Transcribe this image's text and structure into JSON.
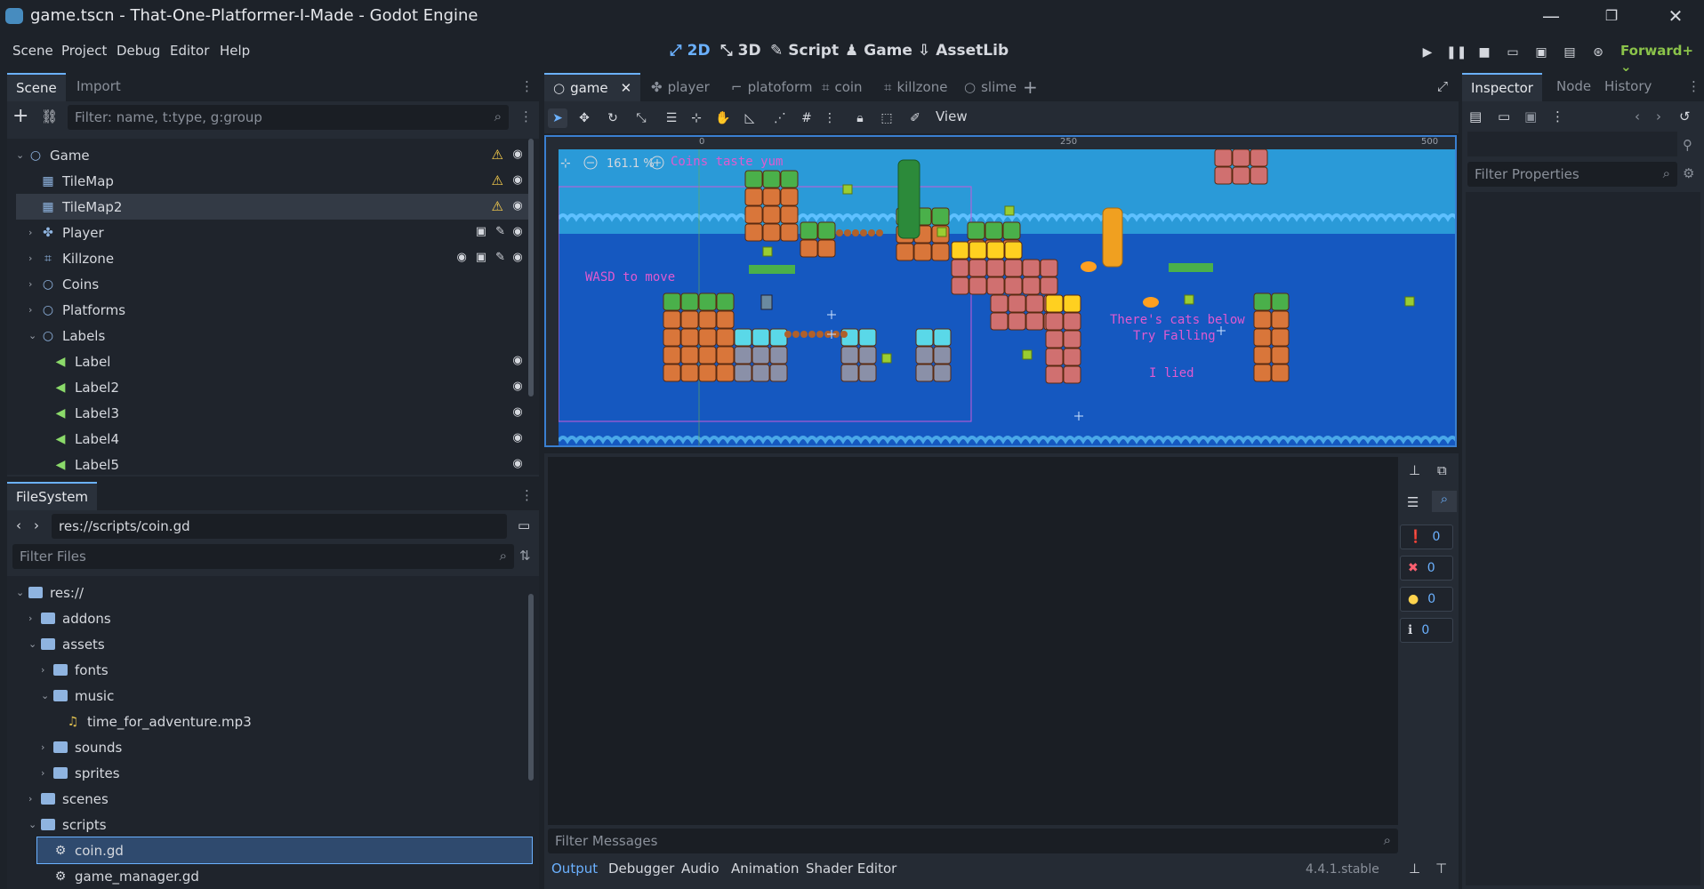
{
  "window": {
    "title": "game.tscn - That-One-Platformer-I-Made - Godot Engine",
    "minimize": "—",
    "maximize": "❐",
    "close": "✕"
  },
  "menu": [
    "Scene",
    "Project",
    "Debug",
    "Editor",
    "Help"
  ],
  "workspaces": [
    {
      "label": "2D",
      "icon": "2d-icon",
      "active": true
    },
    {
      "label": "3D",
      "icon": "3d-icon",
      "active": false
    },
    {
      "label": "Script",
      "icon": "script-icon",
      "active": false
    },
    {
      "label": "Game",
      "icon": "game-icon",
      "active": false
    },
    {
      "label": "AssetLib",
      "icon": "assetlib-icon",
      "active": false
    }
  ],
  "renderer": "Forward+",
  "scene_panel": {
    "tabs": [
      "Scene",
      "Import"
    ],
    "filter_placeholder": "Filter: name, t:type, g:group",
    "nodes": [
      {
        "name": "Game",
        "depth": 0,
        "expanded": true,
        "icon": "node2d-icon",
        "warn": true,
        "eye": true
      },
      {
        "name": "TileMap",
        "depth": 1,
        "icon": "tilemap-icon",
        "warn": true,
        "eye": true
      },
      {
        "name": "TileMap2",
        "depth": 1,
        "icon": "tilemap-icon",
        "warn": true,
        "eye": true,
        "selected": true
      },
      {
        "name": "Player",
        "depth": 1,
        "collapsed": true,
        "icon": "character-icon",
        "eye": true,
        "extras": [
          "scene",
          "script"
        ]
      },
      {
        "name": "Killzone",
        "depth": 1,
        "collapsed": true,
        "icon": "area-icon",
        "eye": true,
        "extras": [
          "signal",
          "scene",
          "script"
        ]
      },
      {
        "name": "Coins",
        "depth": 1,
        "collapsed": true,
        "icon": "node2d-icon"
      },
      {
        "name": "Platforms",
        "depth": 1,
        "collapsed": true,
        "icon": "node2d-icon"
      },
      {
        "name": "Labels",
        "depth": 1,
        "expanded": true,
        "icon": "node2d-icon"
      },
      {
        "name": "Label",
        "depth": 2,
        "icon": "label-icon",
        "eye": true
      },
      {
        "name": "Label2",
        "depth": 2,
        "icon": "label-icon",
        "eye": true
      },
      {
        "name": "Label3",
        "depth": 2,
        "icon": "label-icon",
        "eye": true
      },
      {
        "name": "Label4",
        "depth": 2,
        "icon": "label-icon",
        "eye": true
      },
      {
        "name": "Label5",
        "depth": 2,
        "icon": "label-icon",
        "eye": true
      }
    ]
  },
  "filesystem": {
    "tab": "FileSystem",
    "path": "res://scripts/coin.gd",
    "filter_placeholder": "Filter Files",
    "items": [
      {
        "name": "res://",
        "depth": 0,
        "type": "folder",
        "expanded": true
      },
      {
        "name": "addons",
        "depth": 1,
        "type": "folder",
        "collapsed": true
      },
      {
        "name": "assets",
        "depth": 1,
        "type": "folder",
        "expanded": true
      },
      {
        "name": "fonts",
        "depth": 2,
        "type": "folder",
        "collapsed": true
      },
      {
        "name": "music",
        "depth": 2,
        "type": "folder",
        "expanded": true
      },
      {
        "name": "time_for_adventure.mp3",
        "depth": 3,
        "type": "audio"
      },
      {
        "name": "sounds",
        "depth": 2,
        "type": "folder",
        "collapsed": true
      },
      {
        "name": "sprites",
        "depth": 2,
        "type": "folder",
        "collapsed": true
      },
      {
        "name": "scenes",
        "depth": 1,
        "type": "folder",
        "collapsed": true
      },
      {
        "name": "scripts",
        "depth": 1,
        "type": "folder",
        "expanded": true
      },
      {
        "name": "coin.gd",
        "depth": 2,
        "type": "script",
        "selected": true
      },
      {
        "name": "game_manager.gd",
        "depth": 2,
        "type": "script"
      }
    ]
  },
  "editor_tabs": [
    {
      "label": "game",
      "active": true
    },
    {
      "label": "player"
    },
    {
      "label": "platoform"
    },
    {
      "label": "coin"
    },
    {
      "label": "killzone"
    },
    {
      "label": "slime"
    }
  ],
  "toolbar": {
    "view_label": "View"
  },
  "viewport": {
    "zoom": "161.1 %",
    "ruler_ticks": [
      "0",
      "250",
      "500"
    ],
    "labels": {
      "coins": "Coins taste yum",
      "wasd": "WASD to move",
      "cats1": "There's cats below",
      "cats2": "Try Falling",
      "lied": "I lied"
    }
  },
  "output": {
    "filter_placeholder": "Filter Messages",
    "tabs": [
      "Output",
      "Debugger",
      "Audio",
      "Animation",
      "Shader Editor"
    ],
    "version": "4.4.1.stable",
    "counters": [
      "0",
      "0",
      "0",
      "0"
    ]
  },
  "inspector": {
    "tabs": [
      "Inspector",
      "Node",
      "History"
    ],
    "filter_placeholder": "Filter Properties"
  },
  "colors": {
    "accent": "#6bb1ff",
    "warning": "#ffd34d",
    "sky": "#1566b5",
    "label_pink": "#e05ad0"
  }
}
